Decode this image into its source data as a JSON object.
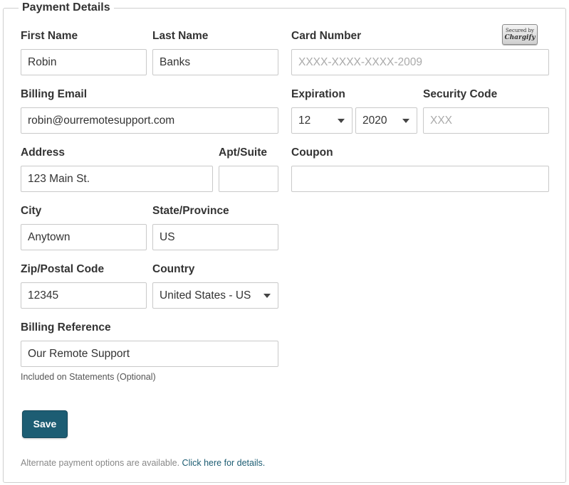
{
  "legend": "Payment Details",
  "badge": {
    "line1": "Secured by",
    "line2": "Chargify"
  },
  "fields": {
    "first_name": {
      "label": "First Name",
      "value": "Robin"
    },
    "last_name": {
      "label": "Last Name",
      "value": "Banks"
    },
    "card_number": {
      "label": "Card Number",
      "placeholder": "XXXX-XXXX-XXXX-2009"
    },
    "billing_email": {
      "label": "Billing Email",
      "value": "robin@ourremotesupport.com"
    },
    "expiration": {
      "label": "Expiration",
      "month": "12",
      "year": "2020"
    },
    "security_code": {
      "label": "Security Code",
      "placeholder": "XXX"
    },
    "address": {
      "label": "Address",
      "value": "123 Main St."
    },
    "apt_suite": {
      "label": "Apt/Suite",
      "value": ""
    },
    "coupon": {
      "label": "Coupon",
      "value": ""
    },
    "city": {
      "label": "City",
      "value": "Anytown"
    },
    "state": {
      "label": "State/Province",
      "value": "US"
    },
    "zip": {
      "label": "Zip/Postal Code",
      "value": "12345"
    },
    "country": {
      "label": "Country",
      "value": "United States - US"
    },
    "billing_reference": {
      "label": "Billing Reference",
      "value": "Our Remote Support",
      "hint": "Included on Statements (Optional)"
    }
  },
  "save_label": "Save",
  "footer": {
    "text": "Alternate payment options are available.",
    "link": "Click here for details."
  },
  "colors": {
    "accent": "#1d5d73",
    "border": "#c9c9c9",
    "placeholder": "#aaaaaa"
  }
}
